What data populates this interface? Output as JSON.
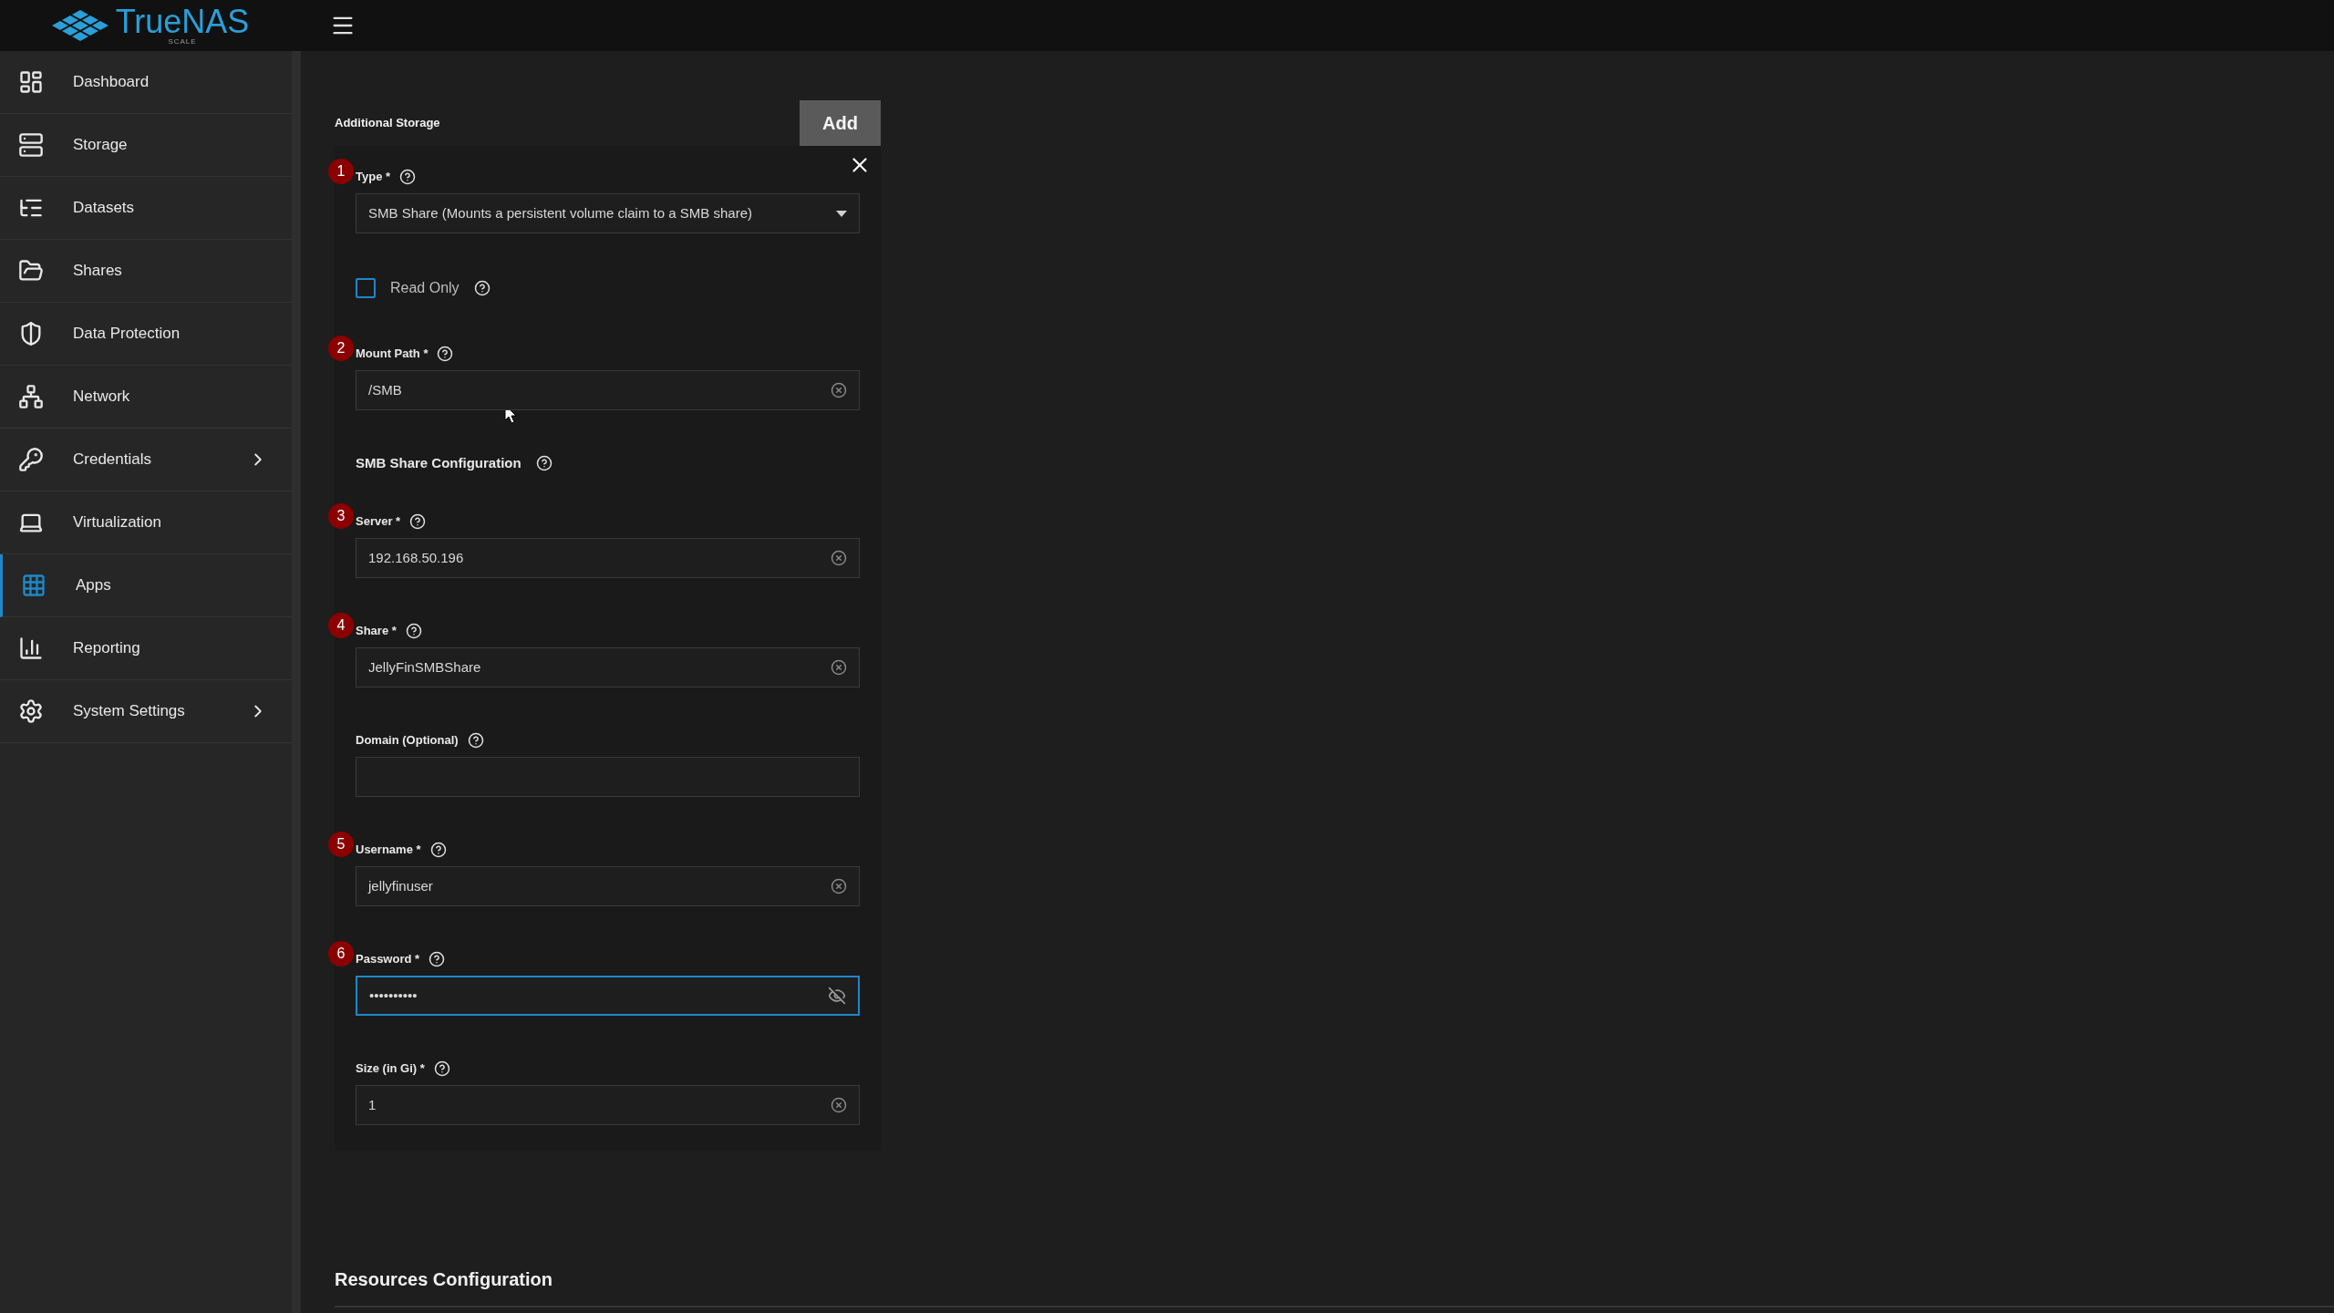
{
  "logo": {
    "name": "TrueNAS",
    "edition": "SCALE"
  },
  "sidebar": {
    "items": [
      {
        "label": "Dashboard",
        "selected": false,
        "has_submenu": false
      },
      {
        "label": "Storage",
        "selected": false,
        "has_submenu": false
      },
      {
        "label": "Datasets",
        "selected": false,
        "has_submenu": false
      },
      {
        "label": "Shares",
        "selected": false,
        "has_submenu": false
      },
      {
        "label": "Data Protection",
        "selected": false,
        "has_submenu": false
      },
      {
        "label": "Network",
        "selected": false,
        "has_submenu": false
      },
      {
        "label": "Credentials",
        "selected": false,
        "has_submenu": true
      },
      {
        "label": "Virtualization",
        "selected": false,
        "has_submenu": false
      },
      {
        "label": "Apps",
        "selected": true,
        "has_submenu": false
      },
      {
        "label": "Reporting",
        "selected": false,
        "has_submenu": false
      },
      {
        "label": "System Settings",
        "selected": false,
        "has_submenu": true
      }
    ]
  },
  "section": {
    "title": "Additional Storage",
    "add_button": "Add"
  },
  "fields": [
    {
      "kind": "select",
      "label": "Type *",
      "value": "SMB Share (Mounts a persistent volume claim to a SMB share)",
      "marker": "1"
    },
    {
      "kind": "checkbox",
      "label": "Read Only",
      "checked": false
    },
    {
      "kind": "text",
      "label": "Mount Path *",
      "value": "/SMB",
      "marker": "2",
      "focused": false
    },
    {
      "kind": "heading",
      "label": "SMB Share Configuration"
    },
    {
      "kind": "text",
      "label": "Server *",
      "value": "192.168.50.196",
      "marker": "3",
      "focused": false
    },
    {
      "kind": "text",
      "label": "Share *",
      "value": "JellyFinSMBShare",
      "marker": "4",
      "focused": false
    },
    {
      "kind": "text",
      "label": "Domain (Optional)",
      "focused": false
    },
    {
      "kind": "text",
      "label": "Username *",
      "value": "jellyfinuser",
      "marker": "5",
      "focused": false
    },
    {
      "kind": "password",
      "label": "Password *",
      "value": "••••••••••",
      "marker": "6",
      "focused": true
    },
    {
      "kind": "text",
      "label": "Size (in Gi) *",
      "value": "1",
      "focused": false
    }
  ],
  "next_section": {
    "title": "Resources Configuration"
  }
}
